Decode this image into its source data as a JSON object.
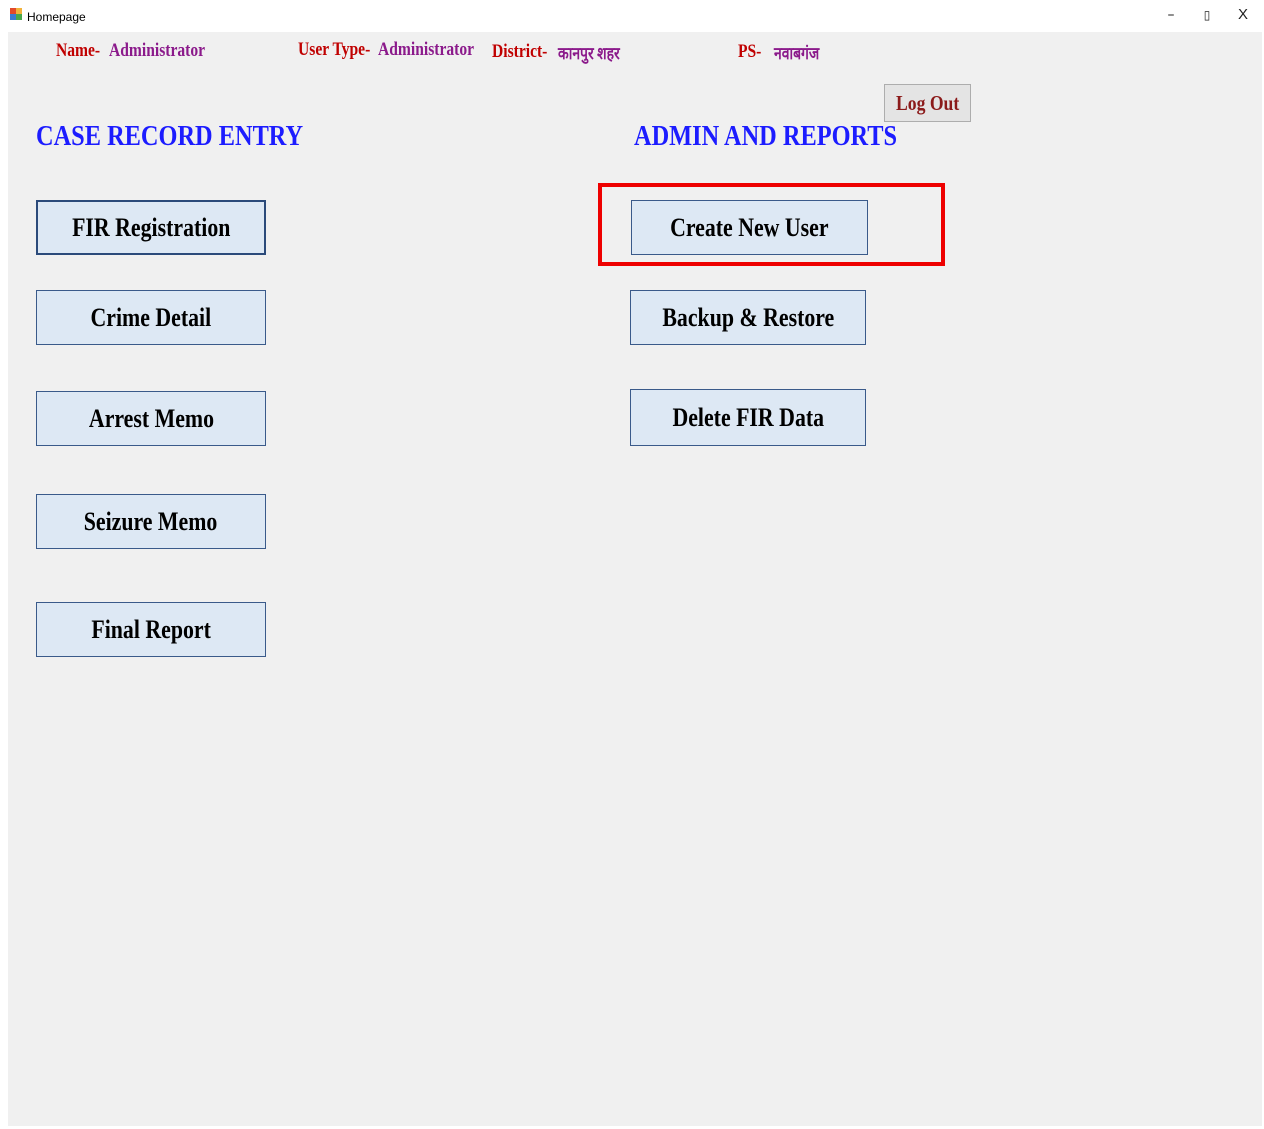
{
  "window": {
    "title": "Homepage",
    "controls": {
      "minimize": "–",
      "maximize": "▯",
      "close": "X"
    }
  },
  "header": {
    "name_label": "Name-",
    "name_value": "Administrator",
    "user_type_label": "User Type-",
    "user_type_value": "Administrator",
    "district_label": "District-",
    "district_value": "कानपुर शहर",
    "ps_label": "PS-",
    "ps_value": "नवाबगंज",
    "logout_label": "Log Out"
  },
  "case_record": {
    "title": "CASE RECORD ENTRY",
    "buttons": [
      {
        "label": "FIR Registration"
      },
      {
        "label": "Crime Detail"
      },
      {
        "label": "Arrest Memo"
      },
      {
        "label": "Seizure Memo"
      },
      {
        "label": "Final Report"
      }
    ]
  },
  "admin": {
    "title": "ADMIN AND REPORTS",
    "buttons": [
      {
        "label": "Create New User"
      },
      {
        "label": "Backup & Restore"
      },
      {
        "label": "Delete FIR Data"
      }
    ]
  },
  "colors": {
    "section_title": "#1c1cff",
    "label_key": "#c00000",
    "label_value": "#8b1a8b",
    "button_bg": "#dde8f4",
    "highlight": "#ee0000"
  }
}
